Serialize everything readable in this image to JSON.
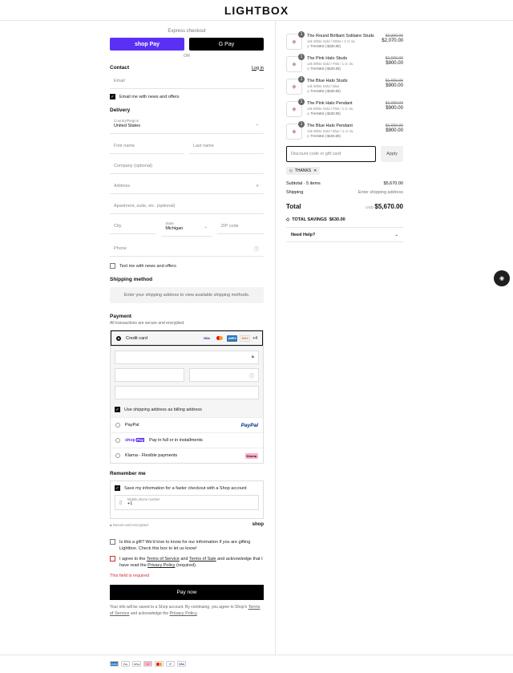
{
  "brand": "LIGHTBOX",
  "express": {
    "title": "Express checkout",
    "shoppay": "shop Pay",
    "gpay": "G Pay",
    "or": "OR"
  },
  "contact": {
    "title": "Contact",
    "login": "Log in",
    "email_placeholder": "Email",
    "news_label": "Email me with news and offers"
  },
  "delivery": {
    "title": "Delivery",
    "country_label": "Country/Region",
    "country_value": "United States",
    "first_name": "First name",
    "last_name": "Last name",
    "company": "Company (optional)",
    "address": "Address",
    "apartment": "Apartment, suite, etc. (optional)",
    "city": "City",
    "state_label": "State",
    "state_value": "Michigan",
    "zip": "ZIP code",
    "phone": "Phone",
    "text_label": "Text me with news and offers"
  },
  "shipping": {
    "title": "Shipping method",
    "message": "Enter your shipping address to view available shipping methods."
  },
  "payment": {
    "title": "Payment",
    "subtitle": "All transactions are secure and encrypted.",
    "credit_card": "Credit card",
    "more_cards": "+4",
    "billing_label": "Use shipping address as billing address",
    "paypal": "PayPal",
    "shoppay_label": "Pay in full or in installments",
    "klarna": "Klarna - Flexible payments"
  },
  "remember": {
    "title": "Remember me",
    "save_label": "Save my information for a faster checkout with a Shop account",
    "mobile_label": "Mobile phone number",
    "mobile_value": "+1",
    "secure": "Secure and encrypted",
    "shop": "shop"
  },
  "gift": {
    "text": "Is this a gift? We'd love to know for our information if you are gifting Lightbox. Check this box to let us know!"
  },
  "agree": {
    "pre": "I agree to the",
    "terms": "Terms of Service",
    "and": "and",
    "sale": "Terms of Sale",
    "mid": "and acknowledge that I have read the",
    "privacy": "Privacy Policy",
    "post": "(required).",
    "error": "This field is required"
  },
  "pay_now": "Pay now",
  "disclaimer": {
    "pre": "Your info will be saved to a Shop account. By continuing, you agree to Shop's",
    "terms": "Terms of Service",
    "mid": "and acknowledge the",
    "privacy": "Privacy Policy",
    "post": "."
  },
  "cart": {
    "items": [
      {
        "qty": "1",
        "name": "The Round Brilliant Solitaire Studs",
        "variant": "14k White Gold / White / 3 ct. tw.",
        "discount": "THANKS (-$230.00)",
        "old_price": "$2,300.00",
        "price": "$2,070.00"
      },
      {
        "qty": "1",
        "name": "The Pink Halo Studs",
        "variant": "14k White Gold / Pink / 1 ct. tw.",
        "discount": "THANKS (-$100.00)",
        "old_price": "$1,000.00",
        "price": "$900.00"
      },
      {
        "qty": "1",
        "name": "The Blue Halo Studs",
        "variant": "14k White Gold / Blue",
        "discount": "THANKS (-$100.00)",
        "old_price": "$1,000.00",
        "price": "$900.00"
      },
      {
        "qty": "1",
        "name": "The Pink Halo Pendant",
        "variant": "14k White Gold / Pink / 1 ct. tw.",
        "discount": "THANKS (-$100.00)",
        "old_price": "$1,000.00",
        "price": "$900.00"
      },
      {
        "qty": "1",
        "name": "The Blue Halo Pendant",
        "variant": "14k White Gold / Blue / 1 ct. tw.",
        "discount": "THANKS (-$100.00)",
        "old_price": "$1,000.00",
        "price": "$900.00"
      }
    ],
    "discount_placeholder": "Discount code or gift card",
    "apply": "Apply",
    "tag": "THANKS",
    "subtotal_label": "Subtotal · 5 items",
    "subtotal": "$5,670.00",
    "shipping_label": "Shipping",
    "shipping_value": "Enter shipping address",
    "total_label": "Total",
    "currency": "USD",
    "total": "$5,670.00",
    "savings_label": "TOTAL SAVINGS",
    "savings": "$630.00",
    "help": "Need Help?"
  }
}
